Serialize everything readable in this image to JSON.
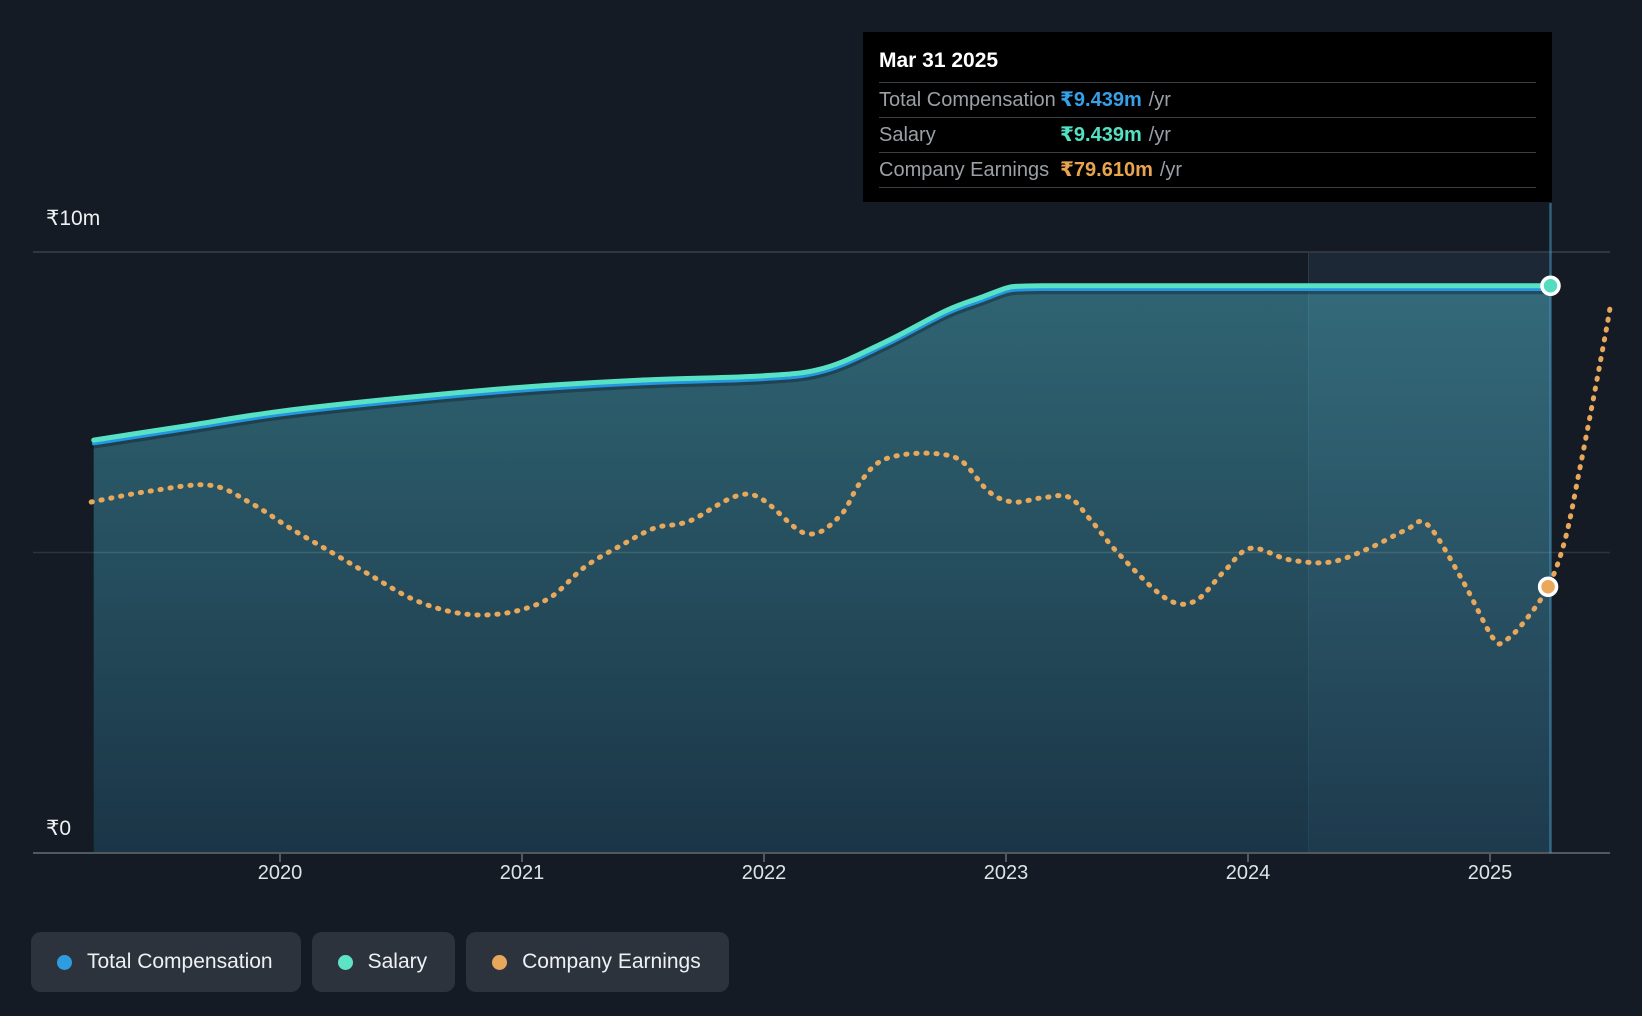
{
  "page": {
    "background": "#141b25"
  },
  "y_axis": {
    "top_label": "₹10m",
    "bottom_label": "₹0"
  },
  "x_axis": {
    "ticks": [
      "2020",
      "2021",
      "2022",
      "2023",
      "2024",
      "2025"
    ]
  },
  "tooltip": {
    "date": "Mar 31 2025",
    "rows": [
      {
        "label": "Total Compensation",
        "value": "₹9.439m",
        "unit": "/yr",
        "color": "#36a0e8"
      },
      {
        "label": "Salary",
        "value": "₹9.439m",
        "unit": "/yr",
        "color": "#55e0c3"
      },
      {
        "label": "Company Earnings",
        "value": "₹79.610m",
        "unit": "/yr",
        "color": "#e9a54e"
      }
    ]
  },
  "legend": {
    "items": [
      {
        "label": "Total Compensation",
        "color": "#2d9de0"
      },
      {
        "label": "Salary",
        "color": "#5fe3c7"
      },
      {
        "label": "Company Earnings",
        "color": "#e8a85c"
      }
    ]
  },
  "chart_data": {
    "type": "line",
    "title": "Executive compensation vs company earnings over time",
    "x_unit": "year (fiscal, Mar 31)",
    "y_unit": "INR millions on visible axis",
    "y_axis_range_m": [
      0,
      10
    ],
    "x_ticks": [
      2020,
      2021,
      2022,
      2023,
      2024,
      2025
    ],
    "grid": "horizontal gridlines at ₹0, ₹5m (unlabeled), ₹10m",
    "legend_position": "bottom-left",
    "highlight_band_years": [
      2024.25,
      2025.25
    ],
    "marker_line_year": 2025.25,
    "note": "Company Earnings is drawn on a hidden separate scale; its tooltip value at Mar 31 2025 is ₹79.610m/yr. Its point values below are plot positions expressed in the visible ₹m axis units.",
    "series": [
      {
        "name": "Total Compensation",
        "color": "#2596e0",
        "style": "solid-under",
        "latest_value": "₹9.439m /yr",
        "points": [
          [
            2019.23,
            6.87
          ],
          [
            2019.6,
            7.1
          ],
          [
            2020,
            7.35
          ],
          [
            2020.5,
            7.57
          ],
          [
            2021,
            7.75
          ],
          [
            2021.5,
            7.87
          ],
          [
            2022,
            7.94
          ],
          [
            2022.25,
            8.07
          ],
          [
            2022.5,
            8.5
          ],
          [
            2022.75,
            9.02
          ],
          [
            2022.9,
            9.25
          ],
          [
            2023.0,
            9.4
          ],
          [
            2023.05,
            9.43
          ],
          [
            2023.15,
            9.439
          ],
          [
            2023.5,
            9.439
          ],
          [
            2024,
            9.439
          ],
          [
            2024.5,
            9.439
          ],
          [
            2025,
            9.439
          ],
          [
            2025.25,
            9.439
          ]
        ]
      },
      {
        "name": "Salary",
        "color": "#58e2c5",
        "style": "solid-area",
        "latest_value": "₹9.439m /yr",
        "points": [
          [
            2019.23,
            6.87
          ],
          [
            2019.6,
            7.1
          ],
          [
            2020,
            7.35
          ],
          [
            2020.5,
            7.57
          ],
          [
            2021,
            7.75
          ],
          [
            2021.5,
            7.87
          ],
          [
            2022,
            7.94
          ],
          [
            2022.25,
            8.07
          ],
          [
            2022.5,
            8.5
          ],
          [
            2022.75,
            9.02
          ],
          [
            2022.9,
            9.25
          ],
          [
            2023.0,
            9.4
          ],
          [
            2023.05,
            9.43
          ],
          [
            2023.15,
            9.439
          ],
          [
            2023.5,
            9.439
          ],
          [
            2024,
            9.439
          ],
          [
            2024.5,
            9.439
          ],
          [
            2025,
            9.439
          ],
          [
            2025.25,
            9.439
          ]
        ]
      },
      {
        "name": "Company Earnings",
        "color": "#e8a85c",
        "style": "dotted",
        "latest_value": "₹79.610m /yr",
        "points": [
          [
            2019.22,
            5.84
          ],
          [
            2019.46,
            6.02
          ],
          [
            2019.71,
            6.12
          ],
          [
            2019.88,
            5.82
          ],
          [
            2020.04,
            5.41
          ],
          [
            2020.21,
            5.01
          ],
          [
            2020.37,
            4.63
          ],
          [
            2020.54,
            4.24
          ],
          [
            2020.69,
            4.03
          ],
          [
            2020.83,
            3.96
          ],
          [
            2020.98,
            4.03
          ],
          [
            2021.12,
            4.26
          ],
          [
            2021.26,
            4.76
          ],
          [
            2021.41,
            5.12
          ],
          [
            2021.55,
            5.41
          ],
          [
            2021.69,
            5.52
          ],
          [
            2021.94,
            5.97
          ],
          [
            2022.17,
            5.32
          ],
          [
            2022.31,
            5.59
          ],
          [
            2022.39,
            6.12
          ],
          [
            2022.47,
            6.49
          ],
          [
            2022.58,
            6.63
          ],
          [
            2022.72,
            6.64
          ],
          [
            2022.82,
            6.51
          ],
          [
            2022.93,
            6.01
          ],
          [
            2023.03,
            5.84
          ],
          [
            2023.15,
            5.91
          ],
          [
            2023.26,
            5.92
          ],
          [
            2023.35,
            5.54
          ],
          [
            2023.47,
            4.96
          ],
          [
            2023.66,
            4.24
          ],
          [
            2023.78,
            4.19
          ],
          [
            2023.9,
            4.68
          ],
          [
            2024.01,
            5.07
          ],
          [
            2024.17,
            4.88
          ],
          [
            2024.34,
            4.84
          ],
          [
            2024.5,
            5.07
          ],
          [
            2024.65,
            5.37
          ],
          [
            2024.74,
            5.47
          ],
          [
            2024.88,
            4.58
          ],
          [
            2025.01,
            3.59
          ],
          [
            2025.06,
            3.53
          ],
          [
            2025.14,
            3.84
          ],
          [
            2025.24,
            4.43
          ],
          [
            2025.31,
            5.21
          ],
          [
            2025.37,
            6.37
          ],
          [
            2025.43,
            7.62
          ],
          [
            2025.48,
            8.7
          ],
          [
            2025.5,
            9.17
          ]
        ]
      }
    ],
    "markers": [
      {
        "series": "Salary",
        "x": 2025.25,
        "y": 9.439,
        "color": "#52dcc0"
      },
      {
        "series": "Company Earnings",
        "x": 2025.24,
        "y": 4.43,
        "color": "#e9a85a"
      }
    ]
  }
}
